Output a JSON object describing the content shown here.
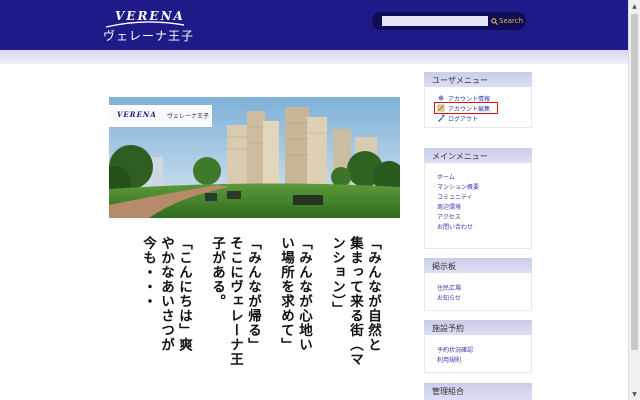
{
  "header": {
    "logo_text": "VERENA",
    "site_name": "ヴェレーナ王子",
    "search_placeholder": "",
    "search_label": "Search"
  },
  "hero": {
    "logo_text": "VERENA",
    "site_name": "ヴェレーナ王子"
  },
  "poem": {
    "columns": [
      "「みんなが自然と",
      "集まって来る街（マ",
      "ンション）」",
      "",
      "「みんなが心地い",
      "い場所を求めて」",
      "",
      "「みんなが帰る」",
      "そこにヴェレーナ王",
      "子がある。",
      "",
      "「こんにちは」爽",
      "やかなあいさつが",
      "今も・・・"
    ]
  },
  "sidebar": {
    "user_menu": {
      "title": "ユーザメニュー",
      "items": [
        {
          "label": "アカウント情報",
          "icon": "info-icon"
        },
        {
          "label": "アカウント編集",
          "icon": "edit-icon",
          "highlighted": true
        },
        {
          "label": "ログアウト",
          "icon": "logout-icon"
        }
      ]
    },
    "main_menu": {
      "title": "メインメニュー",
      "items": [
        "ホーム",
        "マンション概要",
        "コミュニティ",
        "周辺環境",
        "アクセス",
        "お問い合わせ"
      ]
    },
    "bbs": {
      "title": "掲示板",
      "items": [
        "住民広場",
        "お知らせ"
      ]
    },
    "facility": {
      "title": "施設予約",
      "items": [
        "予約状況確認",
        "利用規則"
      ]
    },
    "management": {
      "title": "管理組合"
    }
  },
  "colors": {
    "header_bg": "#1e1a88",
    "highlight_border": "#e01010",
    "link": "#3a3aaa"
  }
}
